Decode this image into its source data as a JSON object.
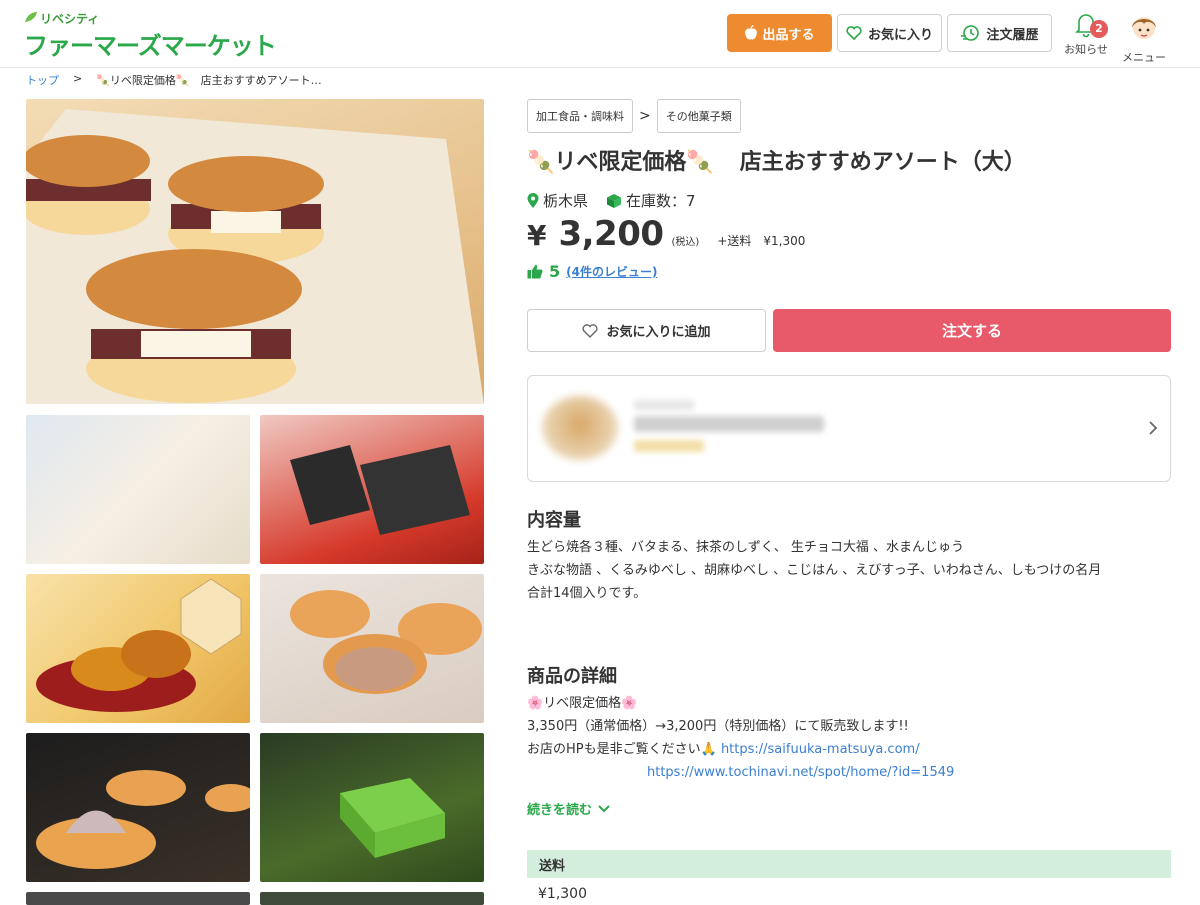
{
  "header": {
    "logo_sub": "リベシティ",
    "logo_main": "ファーマーズマーケット",
    "sell_label": "出品する",
    "favorites_label": "お気に入り",
    "history_label": "注文履歴",
    "notice_label": "お知らせ",
    "notice_count": "2",
    "menu_label": "メニュー"
  },
  "breadcrumb": {
    "top": "トップ",
    "sep": ">",
    "current": "🍡リベ限定価格🍡　店主おすすめアソート…"
  },
  "product": {
    "category": "加工食品・調味料",
    "category_sep": ">",
    "subcategory": "その他菓子類",
    "title_prefix": "🍡リベ限定価格🍡",
    "title_main": "店主おすすめアソート（大）",
    "prefecture": "栃木県",
    "stock": "在庫数：7",
    "currency": "¥",
    "price": "3,200",
    "tax": "(税込)",
    "shipping_inline": "+送料　¥1,300",
    "rating": "5",
    "reviews_link": "(4件のレビュー)",
    "add_fav_label": "お気に入りに追加",
    "order_label": "注文する"
  },
  "content": {
    "heading": "内容量",
    "lines": [
      "生どら焼各３種、バタまる、抹茶のしずく、 生チョコ大福 、水まんじゅう",
      "きぶな物語 、くるみゆべし 、胡麻ゆべし 、こじはん 、えびすっ子、いわねさん、しもつけの名月",
      "合計14個入りです。"
    ]
  },
  "detail": {
    "heading": "商品の詳細",
    "line1": "🌸リベ限定価格🌸",
    "line2": "3,350円（通常価格）→3,200円（特別価格）にて販売致します!!",
    "line3_text": "お店のHPも是非ご覧ください🙏 ",
    "url1": "https://saifuuka-matsuya.com/",
    "url2": "https://www.tochinavi.net/spot/home/?id=1549",
    "read_more": "続きを読む"
  },
  "shipping": {
    "heading": "送料",
    "value": "¥1,300"
  },
  "colors": {
    "accent_green": "#2aa84a",
    "sell_orange": "#ee8a2f",
    "order_red": "#e85a6a",
    "link_blue": "#3b7fd0",
    "shipping_bar": "#d4eedd"
  }
}
